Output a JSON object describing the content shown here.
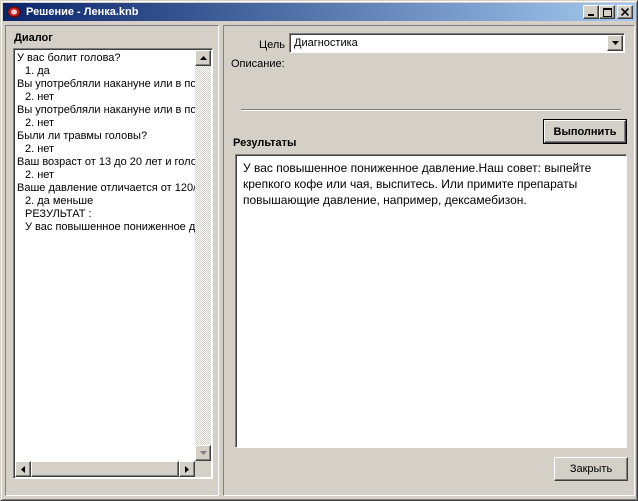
{
  "window": {
    "title": "Решение - Ленка.knb",
    "buttons": {
      "minimize": "_",
      "maximize": "□",
      "close": "✕"
    }
  },
  "dialog": {
    "label": "Диалог",
    "lines": [
      {
        "text": "У вас болит голова?",
        "indent": false
      },
      {
        "text": "1. да",
        "indent": true
      },
      {
        "text": "Вы употребляли накануне или в по",
        "indent": false
      },
      {
        "text": "2. нет",
        "indent": true
      },
      {
        "text": "Вы употребляли накануне или в по",
        "indent": false
      },
      {
        "text": "2. нет",
        "indent": true
      },
      {
        "text": "Были ли травмы головы?",
        "indent": false
      },
      {
        "text": "2. нет",
        "indent": true
      },
      {
        "text": "Ваш возраст от 13 до 20 лет и голо",
        "indent": false
      },
      {
        "text": "2. нет",
        "indent": true
      },
      {
        "text": "Ваше давление отличается от 120/",
        "indent": false
      },
      {
        "text": "2. да меньше",
        "indent": true
      },
      {
        "text": "РЕЗУЛЬТАТ :",
        "indent": true
      },
      {
        "text": "У вас повышенное пониженное  д",
        "indent": true
      }
    ]
  },
  "goal": {
    "label": "Цель",
    "value": "Диагностика"
  },
  "description": {
    "label": "Описание:"
  },
  "results": {
    "label": "Результаты",
    "text": "У вас повышенное пониженное  давление.Наш совет: выпейте крепкого кофе или чая, выспитесь. Или примите препараты повышающие  давление, например, дексамебизон."
  },
  "buttons": {
    "execute": "Выполнить",
    "close": "Закрыть"
  }
}
